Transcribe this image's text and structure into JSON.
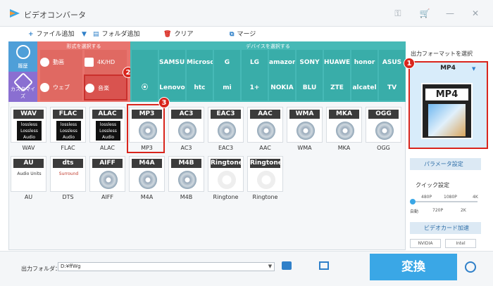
{
  "window": {
    "title": "ビデオコンバータ",
    "icons": {
      "key": "key-icon",
      "cart": "cart-icon",
      "minimize": "minimize-icon",
      "close": "close-icon"
    }
  },
  "toolbar": {
    "add_file": "ファイル追加",
    "add_folder": "フォルダ追加",
    "clear": "クリア",
    "merge": "マージ"
  },
  "sidebar": {
    "history": "履歴",
    "customize": "カスタマイズ"
  },
  "categories": {
    "format_header": "形式を選択する",
    "device_header": "デバイスを選択する",
    "format_tabs": [
      "動画",
      "4K/HD",
      "ウェブ",
      "音楽"
    ],
    "devices_row1": [
      "",
      "SAMSUNG",
      "Microsoft",
      "G",
      "LG",
      "amazon",
      "SONY",
      "HUAWEI",
      "honor",
      "ASUS"
    ],
    "devices_row2": [
      "",
      "Lenovo",
      "htc",
      "mi",
      "1+",
      "NOKIA",
      "BLU",
      "ZTE",
      "alcatel",
      "TV"
    ]
  },
  "badges": {
    "b1": "1",
    "b2": "2",
    "b3": "3"
  },
  "formats": [
    {
      "header": "WAV",
      "name": "WAV",
      "kind": "lossless"
    },
    {
      "header": "FLAC",
      "name": "FLAC",
      "kind": "lossless"
    },
    {
      "header": "ALAC",
      "name": "ALAC",
      "kind": "lossless"
    },
    {
      "header": "MP3",
      "name": "MP3",
      "kind": "disc"
    },
    {
      "header": "AC3",
      "name": "AC3",
      "kind": "disc"
    },
    {
      "header": "EAC3",
      "name": "EAC3",
      "kind": "disc"
    },
    {
      "header": "AAC",
      "name": "AAC",
      "kind": "disc"
    },
    {
      "header": "WMA",
      "name": "WMA",
      "kind": "disc"
    },
    {
      "header": "MKA",
      "name": "MKA",
      "kind": "disc"
    },
    {
      "header": "OGG",
      "name": "OGG",
      "kind": "disc"
    },
    {
      "header": "AU",
      "name": "AU",
      "kind": "au"
    },
    {
      "header": "dts",
      "name": "DTS",
      "kind": "dts"
    },
    {
      "header": "AIFF",
      "name": "AIFF",
      "kind": "disc"
    },
    {
      "header": "M4A",
      "name": "M4A",
      "kind": "disc"
    },
    {
      "header": "M4B",
      "name": "M4B",
      "kind": "disc"
    },
    {
      "header": "Ringtone",
      "name": "Ringtone",
      "kind": "ringtone"
    },
    {
      "header": "Ringtone",
      "name": "Ringtone",
      "kind": "ringtone"
    }
  ],
  "lossless_text": "lossless Lossless Audio",
  "au_text": "Audio Units",
  "dts_text": "Surround",
  "output": {
    "label": "出力フォルダ：",
    "path": "D:¥ffWg"
  },
  "convert_label": "変換",
  "right": {
    "title": "出力フォーマットを選択",
    "selected_format": "MP4",
    "big_label": "MP4",
    "params": "パラメータ設定",
    "quick": "クイック設定",
    "q_top": [
      "480P",
      "1080P",
      "4K"
    ],
    "q_bottom": [
      "自動",
      "720P",
      "2K"
    ],
    "gpu": "ビデオカード加速",
    "nvidia": "NVIDIA",
    "intel": "Intel"
  }
}
